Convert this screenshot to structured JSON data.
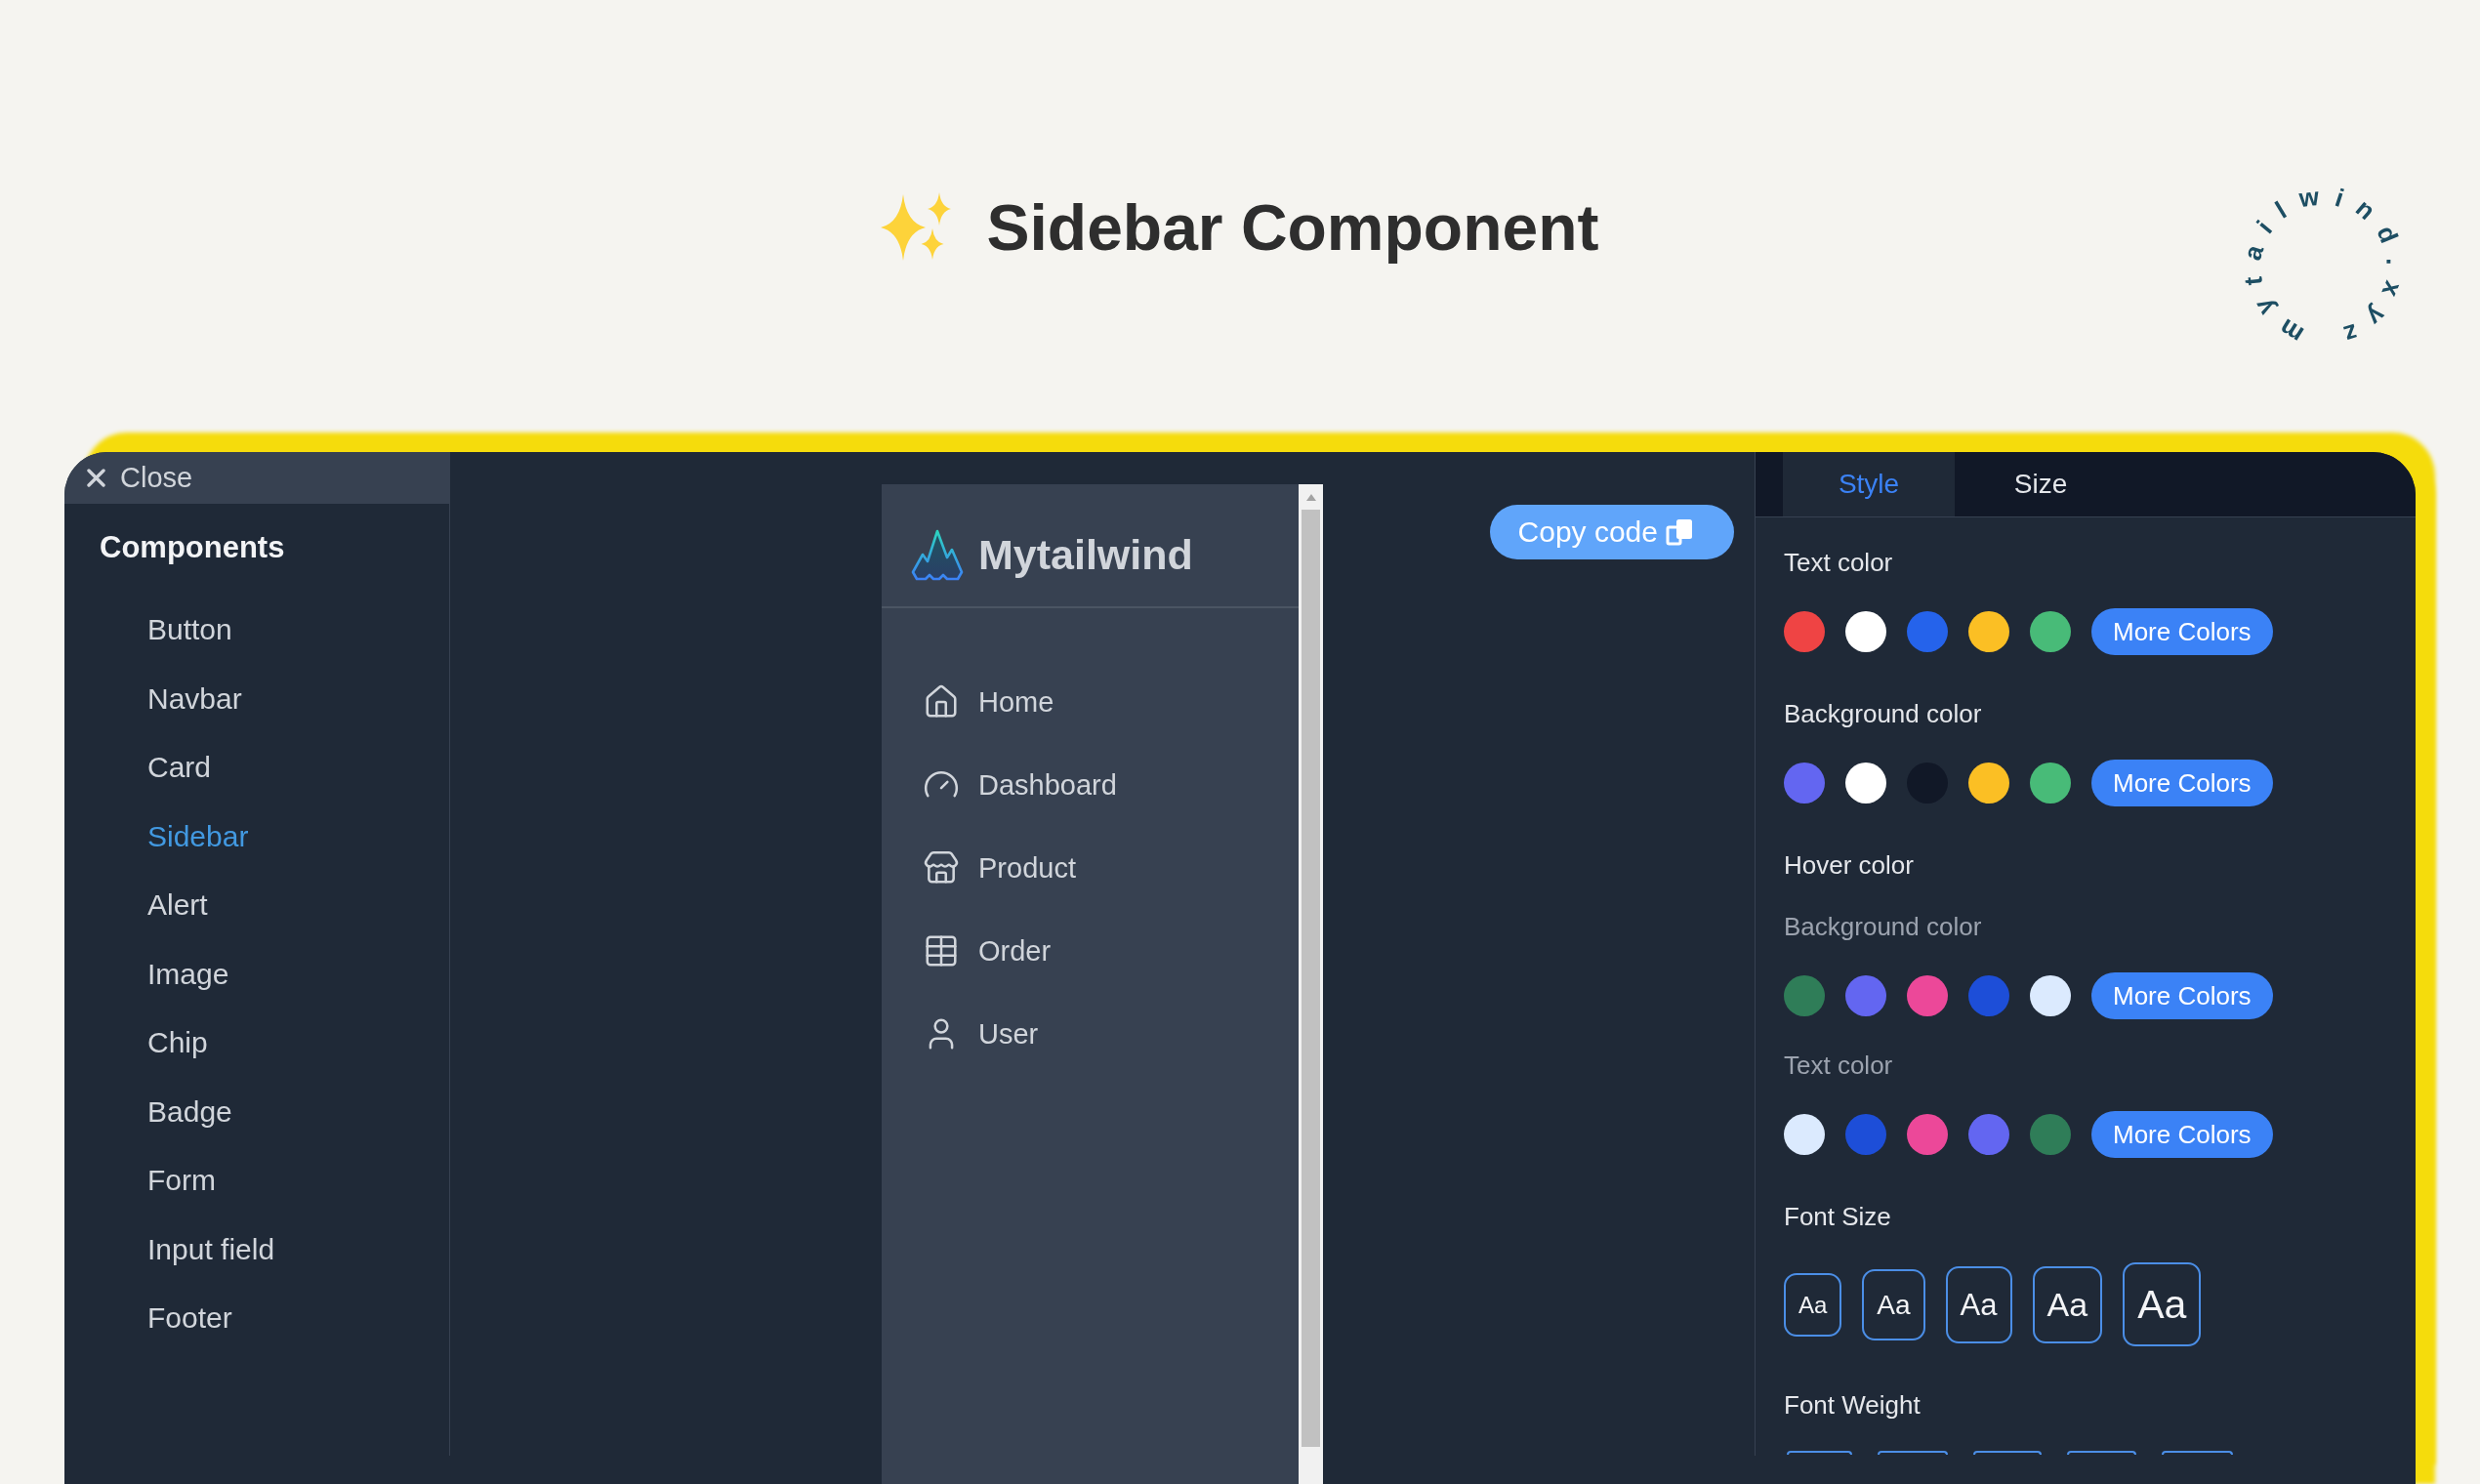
{
  "header": {
    "title": "Sidebar Component",
    "logo_text": "mytailwind.xyz"
  },
  "components_menu": {
    "close_label": "Close",
    "heading": "Components",
    "items": [
      {
        "label": "Button",
        "selected": false
      },
      {
        "label": "Navbar",
        "selected": false
      },
      {
        "label": "Card",
        "selected": false
      },
      {
        "label": "Sidebar",
        "selected": true
      },
      {
        "label": "Alert",
        "selected": false
      },
      {
        "label": "Image",
        "selected": false
      },
      {
        "label": "Chip",
        "selected": false
      },
      {
        "label": "Badge",
        "selected": false
      },
      {
        "label": "Form",
        "selected": false
      },
      {
        "label": "Input field",
        "selected": false
      },
      {
        "label": "Footer",
        "selected": false
      }
    ]
  },
  "preview": {
    "brand": "Mytailwind",
    "nav": [
      {
        "label": "Home"
      },
      {
        "label": "Dashboard"
      },
      {
        "label": "Product"
      },
      {
        "label": "Order"
      },
      {
        "label": "User"
      }
    ]
  },
  "copy_button": {
    "label": "Copy code"
  },
  "style_panel": {
    "tabs": [
      {
        "label": "Style",
        "selected": true
      },
      {
        "label": "Size",
        "selected": false
      }
    ],
    "sections": [
      {
        "kind": "swatches",
        "label": "Text color",
        "swatches": [
          {
            "color": "#ef4444"
          },
          {
            "color": "#ffffff"
          },
          {
            "color": "#2563eb"
          },
          {
            "color": "#fbbf24"
          },
          {
            "color": "#48bb78"
          }
        ],
        "more_button": "More Colors"
      },
      {
        "kind": "swatches",
        "label": "Background color",
        "swatches": [
          {
            "color": "#6366f1"
          },
          {
            "color": "#ffffff"
          },
          {
            "color": "#111827"
          },
          {
            "color": "#fbbf24"
          },
          {
            "color": "#48bb78"
          }
        ],
        "more_button": "More Colors"
      },
      {
        "kind": "group",
        "label": "Hover color",
        "subsections": [
          {
            "label": "Background color",
            "swatches": [
              {
                "color": "#2f7d58"
              },
              {
                "color": "#6366f1"
              },
              {
                "color": "#ec4899"
              },
              {
                "color": "#1d4ed8"
              },
              {
                "color": "#dbeafe"
              }
            ],
            "more_button": "More Colors"
          },
          {
            "label": "Text color",
            "swatches": [
              {
                "color": "#dbeafe"
              },
              {
                "color": "#1d4ed8"
              },
              {
                "color": "#ec4899"
              },
              {
                "color": "#6366f1"
              },
              {
                "color": "#2f7d58"
              }
            ],
            "more_button": "More Colors"
          }
        ]
      },
      {
        "kind": "sizes",
        "label": "Font Size",
        "options": [
          {
            "label": "Aa"
          },
          {
            "label": "Aa"
          },
          {
            "label": "Aa"
          },
          {
            "label": "Aa"
          },
          {
            "label": "Aa"
          }
        ]
      },
      {
        "kind": "weights",
        "label": "Font Weight",
        "options": [
          {
            "kind": "clipped"
          },
          {
            "kind": "clipped"
          },
          {
            "kind": "clipped"
          },
          {
            "kind": "clipped"
          },
          {
            "kind": "clipped"
          }
        ]
      }
    ]
  }
}
